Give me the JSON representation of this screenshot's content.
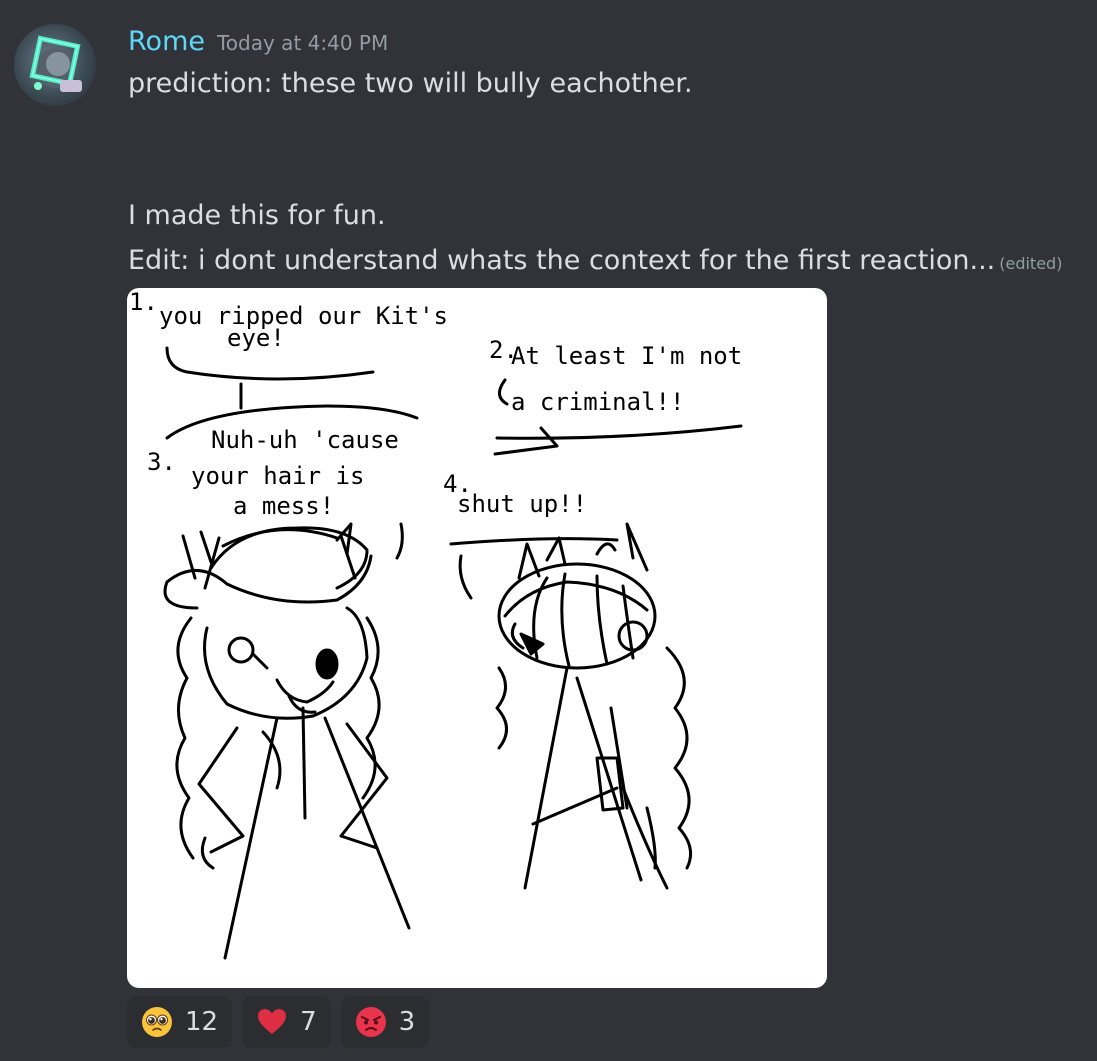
{
  "message": {
    "author": "Rome",
    "timestamp": "Today at 4:40 PM",
    "lines": [
      "prediction: these two will bully eachother.",
      "I made this for fun.",
      "Edit: i dont understand whats the context for the first reaction..."
    ],
    "edited_label": "(edited)",
    "author_color": "#5fd7f8"
  },
  "attachment": {
    "icon": "drawing-image",
    "texts": [
      "1.",
      "you ripped our Kit's",
      "eye!",
      "2.",
      "At least I'm not",
      "a criminal!!",
      "3.",
      "Nuh-uh 'cause",
      "your hair is",
      "a mess!",
      "4.",
      "shut up!!"
    ]
  },
  "reactions": [
    {
      "emoji": "pleading-face-emoji",
      "count": "12"
    },
    {
      "emoji": "red-heart-emoji",
      "count": "7"
    },
    {
      "emoji": "angry-face-emoji",
      "count": "3"
    }
  ]
}
